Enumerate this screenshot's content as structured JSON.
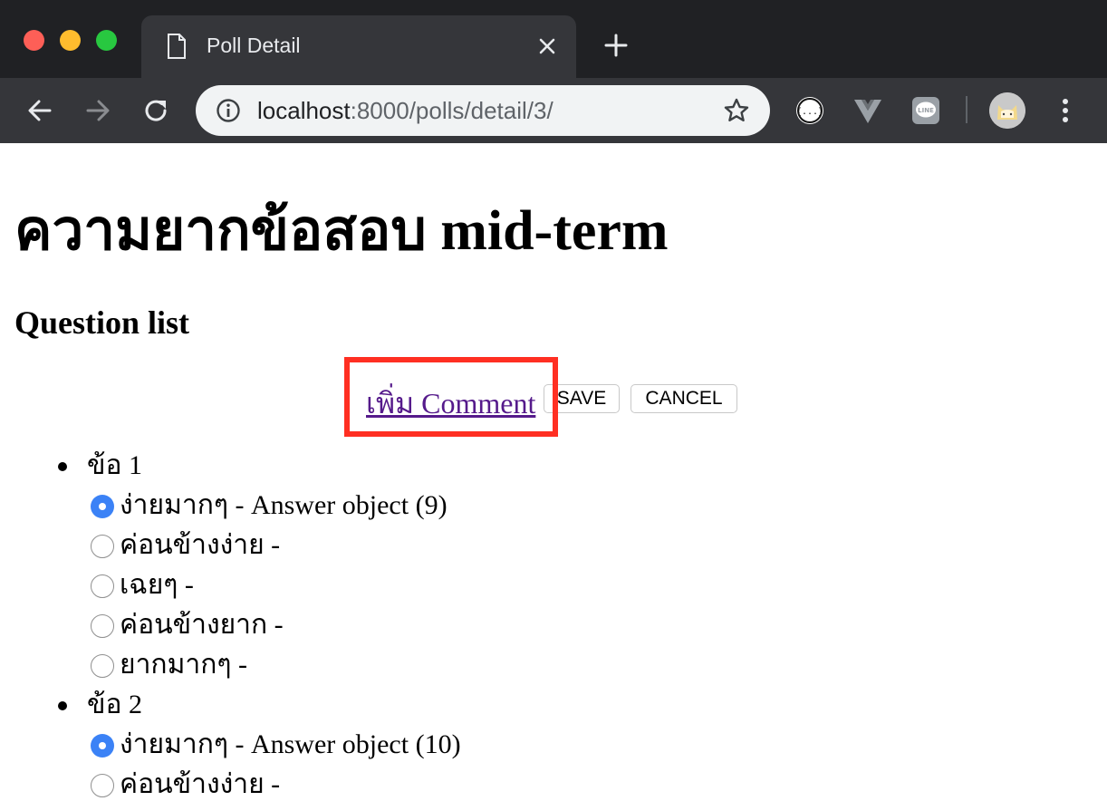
{
  "browser": {
    "tab_title": "Poll Detail",
    "url_host": "localhost",
    "url_rest": ":8000/polls/detail/3/"
  },
  "icons": {
    "traffic_lights": [
      "close-dot",
      "minimize-dot",
      "zoom-dot"
    ],
    "toolbar": [
      "back-icon",
      "forward-icon",
      "reload-icon",
      "info-icon",
      "star-icon",
      "json-extension-icon",
      "vue-extension-icon",
      "line-extension-icon",
      "avatar",
      "menu-icon"
    ]
  },
  "colors": {
    "link": "#551a8b",
    "highlight_box": "#ff2f22",
    "radio_checked": "#3b82f6"
  },
  "page": {
    "title": "ความยากข้อสอบ mid-term",
    "subtitle": "Question list",
    "comment_link": "เพิ่ม Comment",
    "save_label": "SAVE",
    "cancel_label": "CANCEL",
    "questions": [
      {
        "label": "ข้อ 1",
        "choices": [
          {
            "text": "ง่ายมากๆ - Answer object (9)",
            "checked": true
          },
          {
            "text": "ค่อนข้างง่าย -",
            "checked": false
          },
          {
            "text": "เฉยๆ -",
            "checked": false
          },
          {
            "text": "ค่อนข้างยาก -",
            "checked": false
          },
          {
            "text": "ยากมากๆ -",
            "checked": false
          }
        ]
      },
      {
        "label": "ข้อ 2",
        "choices": [
          {
            "text": "ง่ายมากๆ - Answer object (10)",
            "checked": true
          },
          {
            "text": "ค่อนข้างง่าย -",
            "checked": false
          }
        ]
      }
    ]
  }
}
